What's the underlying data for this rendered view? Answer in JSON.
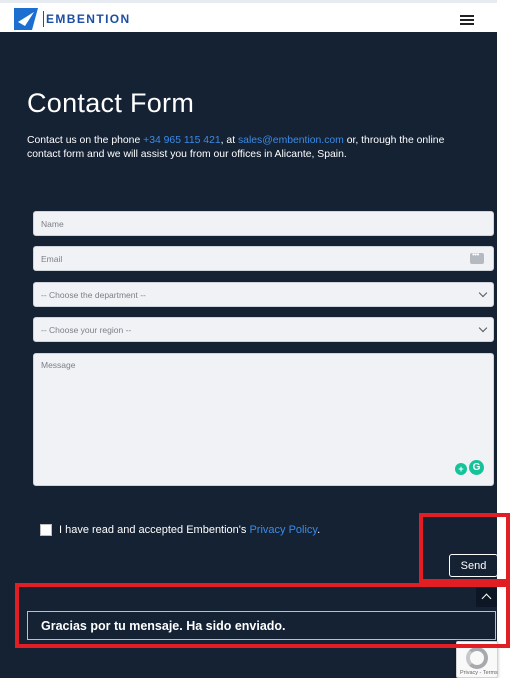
{
  "header": {
    "brand": "EMBENTION",
    "logo_icon": "embention-logo-icon",
    "menu_icon": "hamburger-menu-icon"
  },
  "main": {
    "title": "Contact Form",
    "intro": {
      "text_before_phone": "Contact us on the phone ",
      "phone": "+34 965 115 421",
      "text_before_email": ", at ",
      "email": "sales@embention.com",
      "text_after_email": " or, through the online contact form and we will assist you from our offices in Alicante, Spain."
    }
  },
  "form": {
    "name_placeholder": "Name",
    "email_placeholder": "Email",
    "department_selected": "-- Choose the department --",
    "region_selected": "-- Choose your region --",
    "message_placeholder": "Message",
    "consent_text": "I have read and accepted Embention's ",
    "consent_link": "Privacy Policy",
    "consent_suffix": ".",
    "send_label": "Send",
    "consent_checked": false
  },
  "response": {
    "message": "Gracias por tu mensaje. Ha sido enviado."
  },
  "recaptcha": {
    "terms": "Privacy - Terms"
  },
  "colors": {
    "background": "#142234",
    "link": "#3b8be8",
    "highlight": "#e01e24",
    "brand": "#1c4fa3"
  }
}
